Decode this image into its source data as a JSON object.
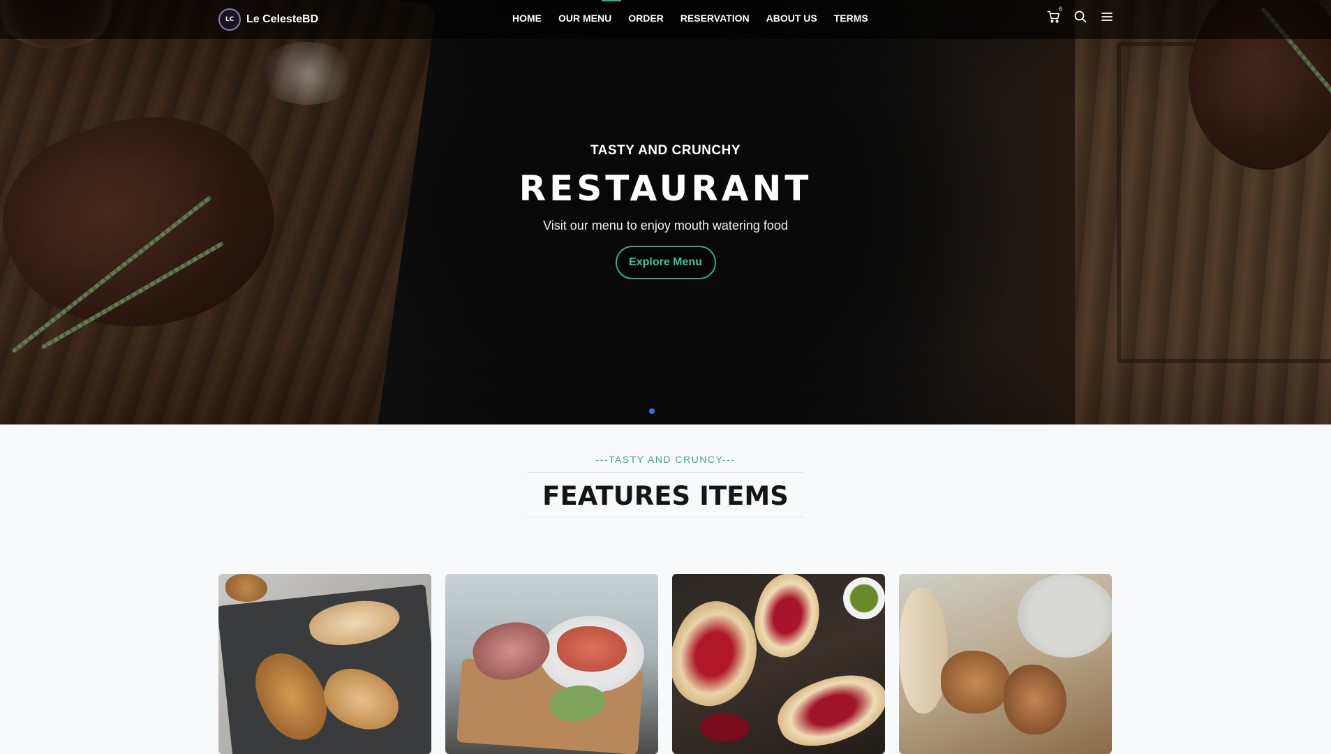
{
  "brand": {
    "logo_mark": "LC",
    "name": "Le CelesteBD"
  },
  "nav": {
    "items": [
      {
        "label": "HOME"
      },
      {
        "label": "OUR MENU"
      },
      {
        "label": "ORDER"
      },
      {
        "label": "RESERVATION"
      },
      {
        "label": "ABOUT US"
      },
      {
        "label": "TERMS"
      }
    ],
    "cart_count": "6",
    "icons": [
      "cart-icon",
      "search-icon",
      "menu-icon"
    ]
  },
  "hero": {
    "kicker": "TASTY AND CRUNCHY",
    "title": "RESTAURANT",
    "subtitle": "Visit our menu to enjoy mouth watering food",
    "button_label": "Explore Menu",
    "active_slide": 1,
    "slide_count": 1
  },
  "features": {
    "kicker": "---TASTY AND CRUNCY---",
    "title": "FEATURES ITEMS"
  },
  "colors": {
    "accent": "#2fae8f",
    "dot_active": "#1a7fe0",
    "page_bg": "#f7f9fb"
  }
}
